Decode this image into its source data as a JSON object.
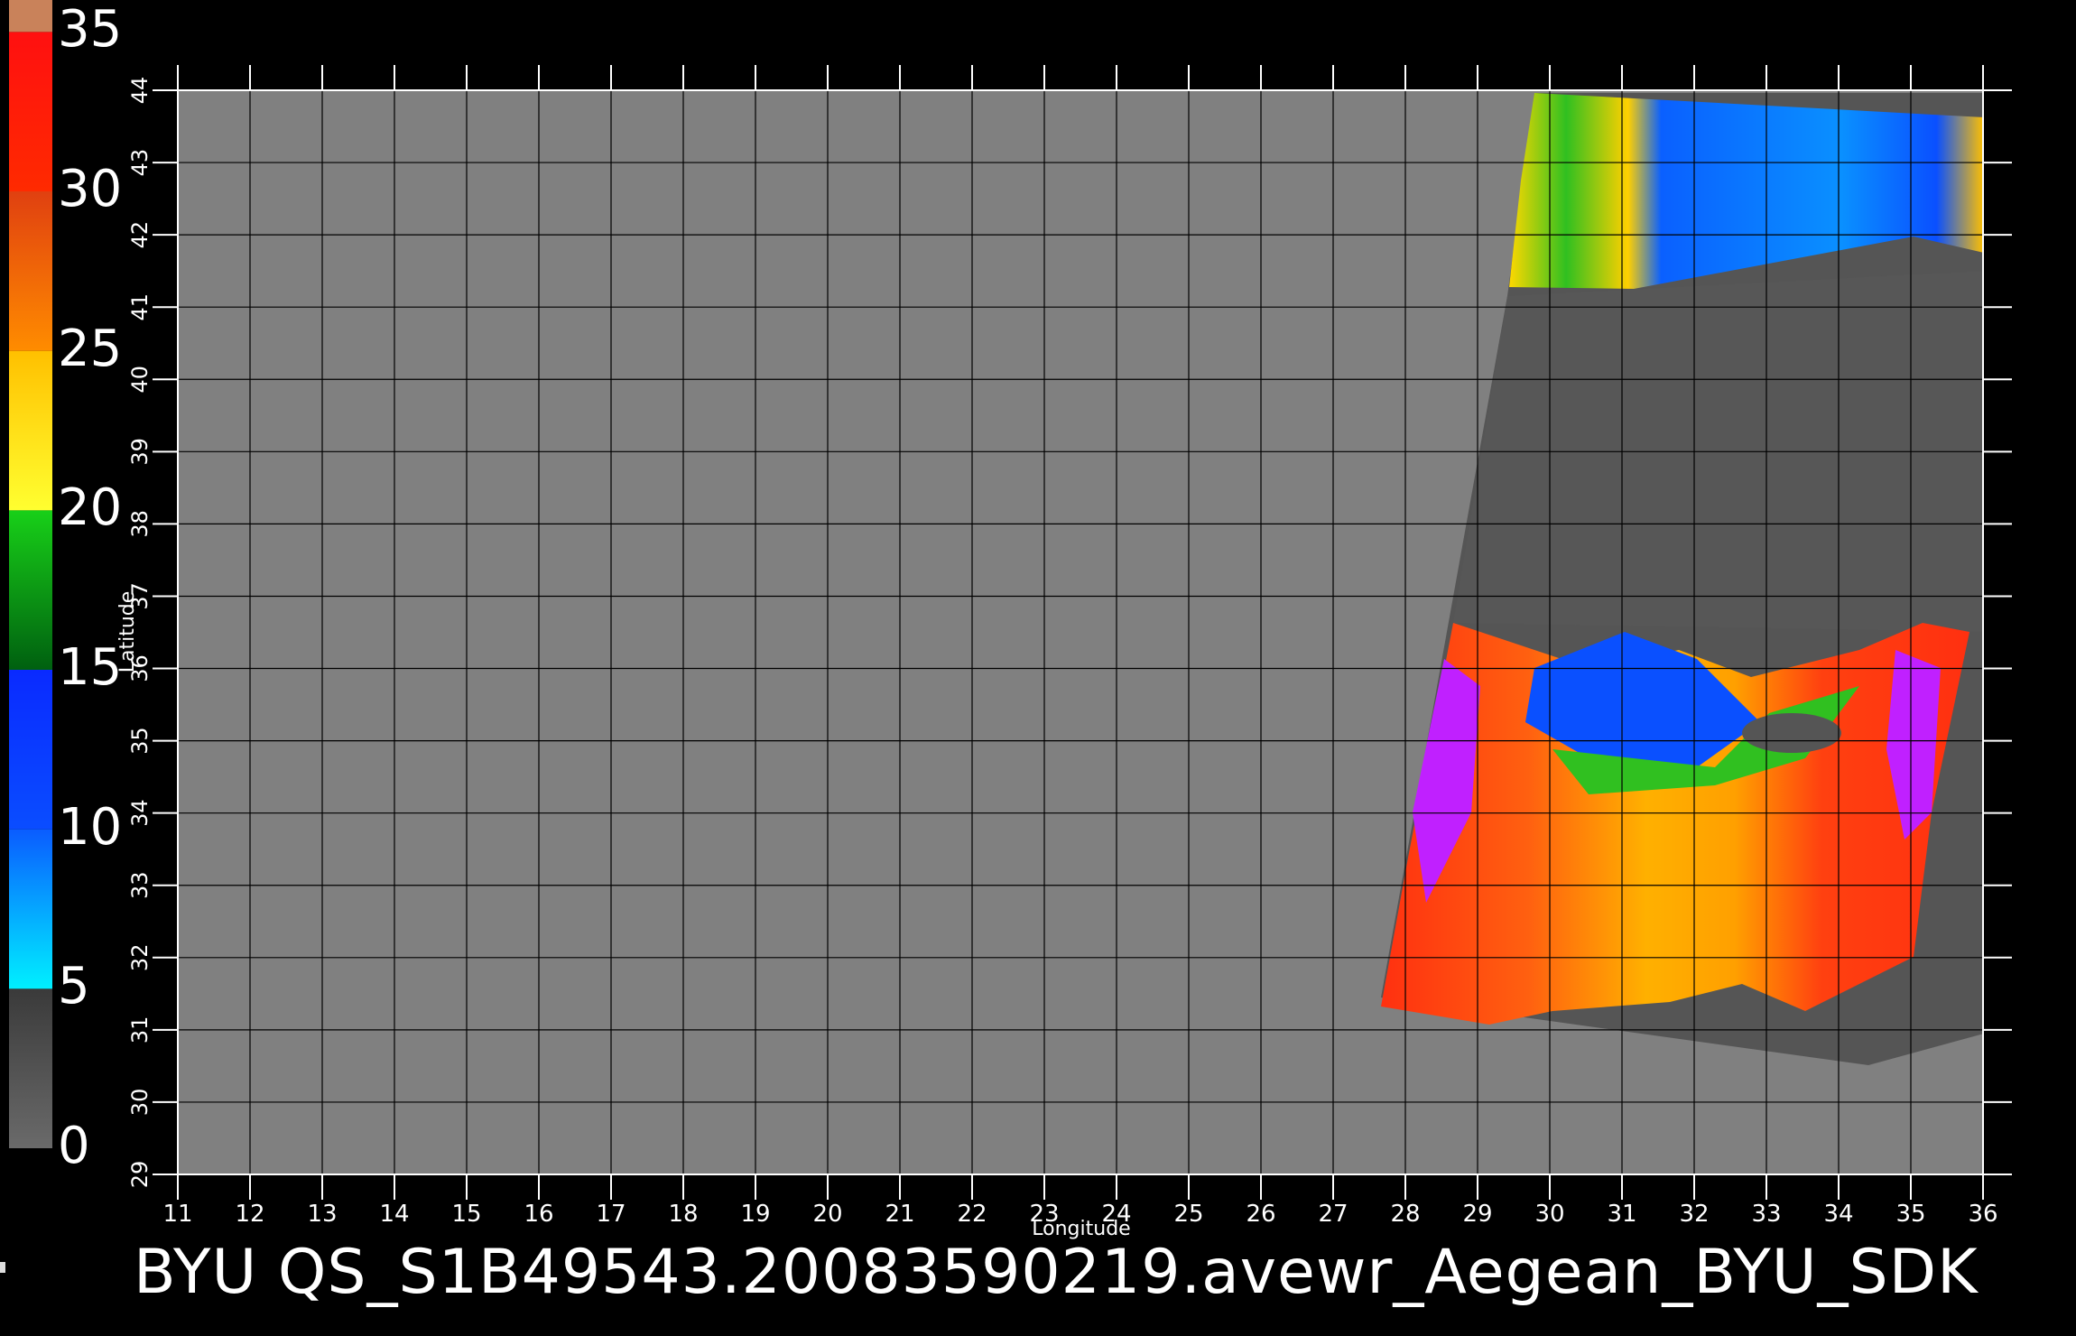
{
  "title": "BYU  QS_S1B49543.20083590219.avewr_Aegean_BYU_SDK",
  "colorbar": {
    "labels": [
      "0",
      "5",
      "10",
      "15",
      "20",
      "25",
      "30",
      "35"
    ],
    "segments": [
      {
        "from": 0,
        "to": 5,
        "colors": [
          "#6a6a6a",
          "#3a3a3a"
        ]
      },
      {
        "from": 5,
        "to": 10,
        "colors": [
          "#00f0ff",
          "#0a5cff"
        ]
      },
      {
        "from": 10,
        "to": 15,
        "colors": [
          "#0a4dff",
          "#0a2aff"
        ]
      },
      {
        "from": 15,
        "to": 20,
        "colors": [
          "#006010",
          "#18d018"
        ]
      },
      {
        "from": 20,
        "to": 25,
        "colors": [
          "#ffff30",
          "#ffc000"
        ]
      },
      {
        "from": 25,
        "to": 30,
        "colors": [
          "#ff8c00",
          "#e04010"
        ]
      },
      {
        "from": 30,
        "to": 35,
        "colors": [
          "#ff2a00",
          "#ff1010"
        ]
      },
      {
        "from": 35,
        "to": 36,
        "colors": [
          "#c9825a",
          "#c9825a"
        ]
      }
    ]
  },
  "map": {
    "x_axis": {
      "label": "Longitude",
      "min": 11,
      "max": 36,
      "ticks": [
        11,
        12,
        13,
        14,
        15,
        16,
        17,
        18,
        19,
        20,
        21,
        22,
        23,
        24,
        25,
        26,
        27,
        28,
        29,
        30,
        31,
        32,
        33,
        34,
        35,
        36
      ]
    },
    "y_axis": {
      "label": "Latitude",
      "min": 29,
      "max": 44,
      "ticks": [
        29,
        30,
        31,
        32,
        33,
        34,
        35,
        36,
        37,
        38,
        39,
        40,
        41,
        42,
        43,
        44
      ]
    },
    "grid": true,
    "background_color": "#808080",
    "land_color": "#505050"
  }
}
